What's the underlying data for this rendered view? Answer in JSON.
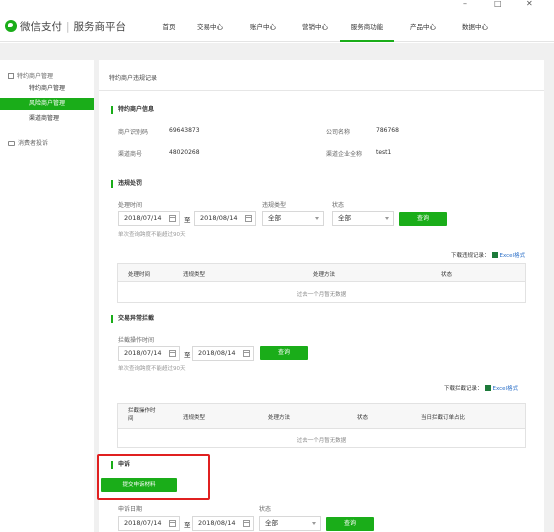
{
  "window": {
    "minimize": "–",
    "maximize": "□",
    "close": "✕"
  },
  "brand": {
    "name": "微信支付",
    "platform": "服务商平台"
  },
  "nav": [
    {
      "label": "首页"
    },
    {
      "label": "交易中心"
    },
    {
      "label": "账户中心"
    },
    {
      "label": "营销中心"
    },
    {
      "label": "服务商功能"
    },
    {
      "label": "产品中心"
    },
    {
      "label": "数据中心"
    }
  ],
  "sidebar": {
    "group1": "特约商户管理",
    "items": [
      {
        "label": "特约商户管理"
      },
      {
        "label": "风险商户管理"
      },
      {
        "label": "渠道商管理"
      }
    ],
    "group2": "消费者投诉"
  },
  "page": {
    "title": "特约商户违规记录"
  },
  "merchant_info": {
    "title": "特约商户信息",
    "merchant_no_label": "商户识别码",
    "merchant_no": "69643873",
    "company_label": "公司名称",
    "company": "786768",
    "channel_no_label": "渠道商号",
    "channel_no": "48020268",
    "channel_company_label": "渠道企业全称",
    "channel_company": "test1"
  },
  "violation": {
    "title": "违规处罚",
    "time_label": "处理时间",
    "start": "2018/07/14",
    "to": "至",
    "end": "2018/08/14",
    "type_label": "违规类型",
    "type_value": "全部",
    "status_label": "状态",
    "status_value": "全部",
    "query": "查询",
    "hint": "单次查询跨度不能超过90天",
    "download": "下载违规记录：",
    "excel": "Excel格式",
    "columns": [
      "处理时间",
      "违规类型",
      "处理方法",
      "状态"
    ],
    "empty": "过去一个月暂无数据"
  },
  "interception": {
    "title": "交易异常拦截",
    "time_label": "拦截操作时间",
    "start": "2018/07/14",
    "to": "至",
    "end": "2018/08/14",
    "query": "查询",
    "hint": "单次查询跨度不能超过90天",
    "download": "下载拦截记录：",
    "excel": "Excel格式",
    "columns": [
      "拦截操作时间",
      "违规类型",
      "处理方法",
      "状态",
      "当日拦截订单占比"
    ],
    "empty": "过去一个月暂无数据"
  },
  "appeal": {
    "title": "申诉",
    "submit": "提交申诉材料",
    "date_label": "申诉日期",
    "start": "2018/07/14",
    "to": "至",
    "end": "2018/08/14",
    "status_label": "状态",
    "status_value": "全部",
    "query": "查询"
  },
  "colors": {
    "accent": "#1aad19",
    "highlight": "#e02020",
    "link": "#2f72c9"
  }
}
